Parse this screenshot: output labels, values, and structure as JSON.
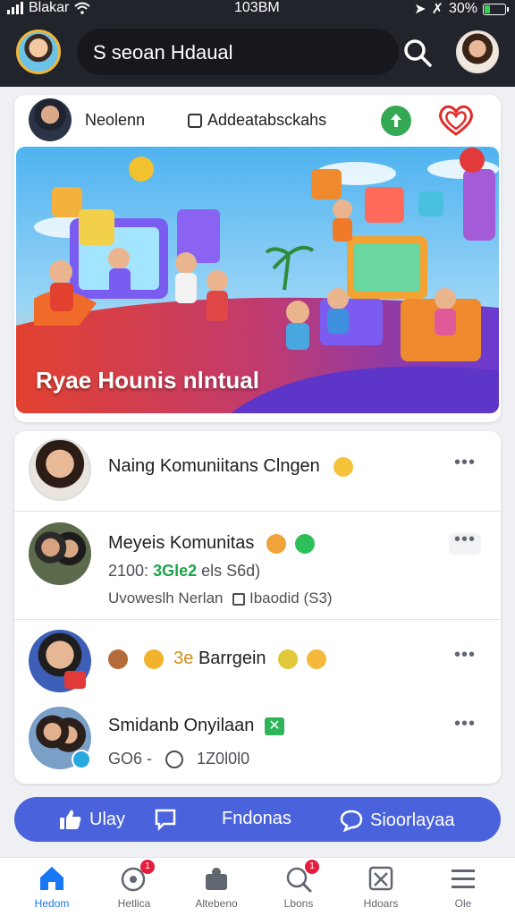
{
  "status_bar": {
    "carrier": "Blakar",
    "time": "103BM",
    "battery": "30%",
    "battery_level": 0.3
  },
  "header": {
    "search_text": "S seoan Hdaual"
  },
  "feature_card": {
    "author": "Neolenn",
    "add_label": "Addeatabsckahs",
    "banner_caption": "Ryae Hounis nlntual"
  },
  "list": [
    {
      "title": "Naing Komuniitans Clngen"
    },
    {
      "title": "Meyeis Komunitas",
      "meta_prefix": "2100:",
      "meta_highlight": "3Gle2",
      "meta_suffix": "els S6d)",
      "detail": "Uvoweslh Nerlan",
      "detail_tag": "Ibaodid (S3)"
    },
    {
      "prefix": "3e",
      "title": "Barrgein"
    },
    {
      "title": "Smidanb Onyilaan",
      "meta_left": "GO6 -",
      "meta_right": "1Z0l0l0"
    }
  ],
  "actions": {
    "like": "Ulay",
    "comment": "Fndonas",
    "share": "Sioorlayaa"
  },
  "nav": [
    {
      "label": "Hedom",
      "icon": "home-icon",
      "active": true
    },
    {
      "label": "Hetlica",
      "icon": "target-icon",
      "badge": "1"
    },
    {
      "label": "Altebeno",
      "icon": "people-icon"
    },
    {
      "label": "Lbons",
      "icon": "search-icon",
      "badge": "1"
    },
    {
      "label": "Hdoars",
      "icon": "marketplace-icon"
    },
    {
      "label": "Ole",
      "icon": "menu-icon"
    }
  ],
  "colors": {
    "header_bg": "#22242b",
    "accent": "#4a63dc",
    "active": "#1877f2",
    "highlight": "#1aa34a"
  }
}
